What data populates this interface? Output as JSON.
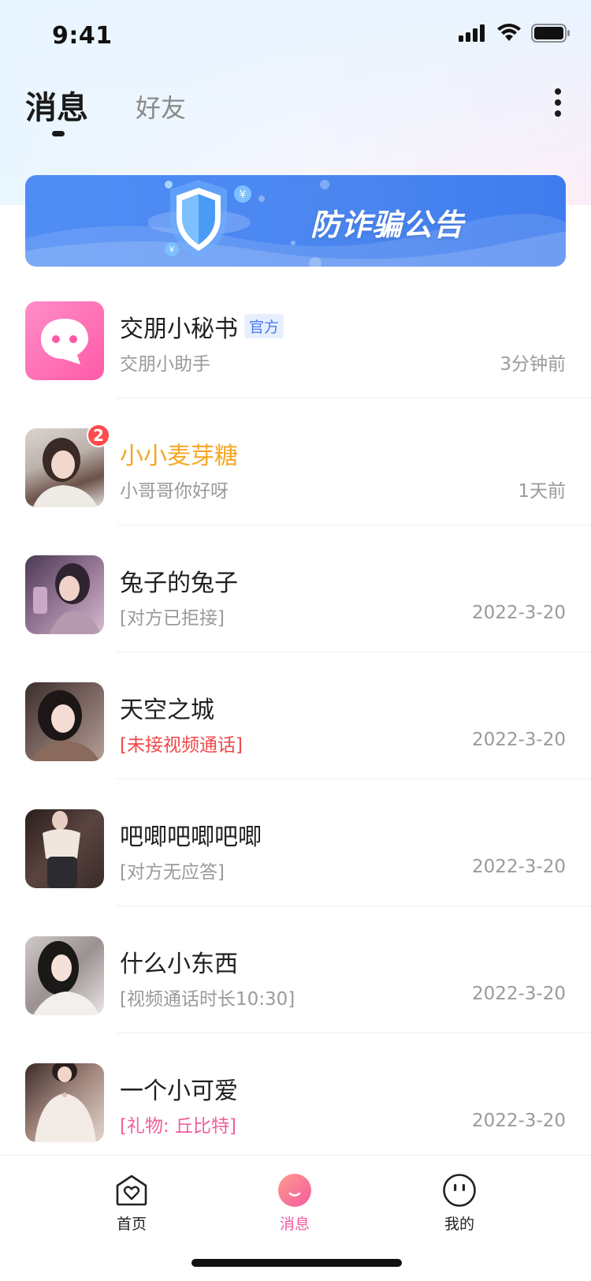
{
  "status_bar": {
    "time": "9:41"
  },
  "header": {
    "tabs": [
      {
        "label": "消息",
        "active": true
      },
      {
        "label": "好友",
        "active": false
      }
    ]
  },
  "banner": {
    "title": "防诈骗公告"
  },
  "messages": [
    {
      "name": "交朋小秘书",
      "tag": "官方",
      "preview": "交朋小助手",
      "time": "3分钟前",
      "avatar": "chat-bubble-icon",
      "preview_color": "gray"
    },
    {
      "name": "小小麦芽糖",
      "badge": "2",
      "preview": "小哥哥你好呀",
      "time": "1天前",
      "name_color": "#f5a623",
      "preview_color": "gray"
    },
    {
      "name": "兔子的兔子",
      "preview": "[对方已拒接]",
      "time": "2022-3-20",
      "preview_color": "gray"
    },
    {
      "name": "天空之城",
      "preview": "[未接视频通话]",
      "time": "2022-3-20",
      "preview_color": "#f04848"
    },
    {
      "name": "吧唧吧唧吧唧",
      "preview": "[对方无应答]",
      "time": "2022-3-20",
      "preview_color": "gray"
    },
    {
      "name": "什么小东西",
      "preview": "[视频通话时长10:30]",
      "time": "2022-3-20",
      "preview_color": "gray"
    },
    {
      "name": "一个小可爱",
      "preview": "[礼物: 丘比特]",
      "time": "2022-3-20",
      "preview_color": "#f0609e"
    }
  ],
  "tabbar": {
    "items": [
      {
        "label": "首页",
        "icon": "home-heart-icon",
        "active": false
      },
      {
        "label": "消息",
        "icon": "message-smile-icon",
        "active": true
      },
      {
        "label": "我的",
        "icon": "profile-face-icon",
        "active": false
      }
    ]
  },
  "colors": {
    "accent": "#f35aa0",
    "banner_blue": "#4f8df5",
    "highlight_name": "#f5a623",
    "badge_red": "#ff4b4b"
  }
}
